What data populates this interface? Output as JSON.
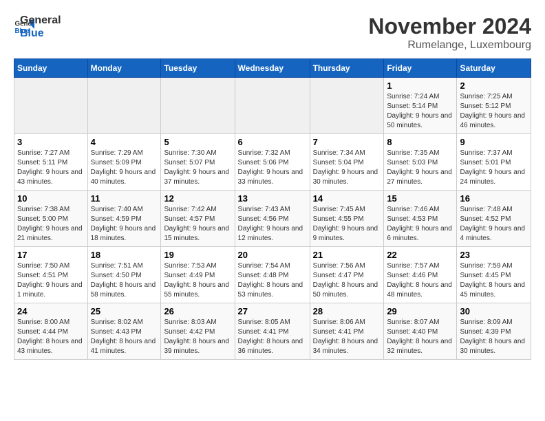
{
  "header": {
    "logo_line1": "General",
    "logo_line2": "Blue",
    "month_title": "November 2024",
    "location": "Rumelange, Luxembourg"
  },
  "days_of_week": [
    "Sunday",
    "Monday",
    "Tuesday",
    "Wednesday",
    "Thursday",
    "Friday",
    "Saturday"
  ],
  "weeks": [
    [
      {
        "day": "",
        "empty": true
      },
      {
        "day": "",
        "empty": true
      },
      {
        "day": "",
        "empty": true
      },
      {
        "day": "",
        "empty": true
      },
      {
        "day": "",
        "empty": true
      },
      {
        "day": "1",
        "sunrise": "Sunrise: 7:24 AM",
        "sunset": "Sunset: 5:14 PM",
        "daylight": "Daylight: 9 hours and 50 minutes."
      },
      {
        "day": "2",
        "sunrise": "Sunrise: 7:25 AM",
        "sunset": "Sunset: 5:12 PM",
        "daylight": "Daylight: 9 hours and 46 minutes."
      }
    ],
    [
      {
        "day": "3",
        "sunrise": "Sunrise: 7:27 AM",
        "sunset": "Sunset: 5:11 PM",
        "daylight": "Daylight: 9 hours and 43 minutes."
      },
      {
        "day": "4",
        "sunrise": "Sunrise: 7:29 AM",
        "sunset": "Sunset: 5:09 PM",
        "daylight": "Daylight: 9 hours and 40 minutes."
      },
      {
        "day": "5",
        "sunrise": "Sunrise: 7:30 AM",
        "sunset": "Sunset: 5:07 PM",
        "daylight": "Daylight: 9 hours and 37 minutes."
      },
      {
        "day": "6",
        "sunrise": "Sunrise: 7:32 AM",
        "sunset": "Sunset: 5:06 PM",
        "daylight": "Daylight: 9 hours and 33 minutes."
      },
      {
        "day": "7",
        "sunrise": "Sunrise: 7:34 AM",
        "sunset": "Sunset: 5:04 PM",
        "daylight": "Daylight: 9 hours and 30 minutes."
      },
      {
        "day": "8",
        "sunrise": "Sunrise: 7:35 AM",
        "sunset": "Sunset: 5:03 PM",
        "daylight": "Daylight: 9 hours and 27 minutes."
      },
      {
        "day": "9",
        "sunrise": "Sunrise: 7:37 AM",
        "sunset": "Sunset: 5:01 PM",
        "daylight": "Daylight: 9 hours and 24 minutes."
      }
    ],
    [
      {
        "day": "10",
        "sunrise": "Sunrise: 7:38 AM",
        "sunset": "Sunset: 5:00 PM",
        "daylight": "Daylight: 9 hours and 21 minutes."
      },
      {
        "day": "11",
        "sunrise": "Sunrise: 7:40 AM",
        "sunset": "Sunset: 4:59 PM",
        "daylight": "Daylight: 9 hours and 18 minutes."
      },
      {
        "day": "12",
        "sunrise": "Sunrise: 7:42 AM",
        "sunset": "Sunset: 4:57 PM",
        "daylight": "Daylight: 9 hours and 15 minutes."
      },
      {
        "day": "13",
        "sunrise": "Sunrise: 7:43 AM",
        "sunset": "Sunset: 4:56 PM",
        "daylight": "Daylight: 9 hours and 12 minutes."
      },
      {
        "day": "14",
        "sunrise": "Sunrise: 7:45 AM",
        "sunset": "Sunset: 4:55 PM",
        "daylight": "Daylight: 9 hours and 9 minutes."
      },
      {
        "day": "15",
        "sunrise": "Sunrise: 7:46 AM",
        "sunset": "Sunset: 4:53 PM",
        "daylight": "Daylight: 9 hours and 6 minutes."
      },
      {
        "day": "16",
        "sunrise": "Sunrise: 7:48 AM",
        "sunset": "Sunset: 4:52 PM",
        "daylight": "Daylight: 9 hours and 4 minutes."
      }
    ],
    [
      {
        "day": "17",
        "sunrise": "Sunrise: 7:50 AM",
        "sunset": "Sunset: 4:51 PM",
        "daylight": "Daylight: 9 hours and 1 minute."
      },
      {
        "day": "18",
        "sunrise": "Sunrise: 7:51 AM",
        "sunset": "Sunset: 4:50 PM",
        "daylight": "Daylight: 8 hours and 58 minutes."
      },
      {
        "day": "19",
        "sunrise": "Sunrise: 7:53 AM",
        "sunset": "Sunset: 4:49 PM",
        "daylight": "Daylight: 8 hours and 55 minutes."
      },
      {
        "day": "20",
        "sunrise": "Sunrise: 7:54 AM",
        "sunset": "Sunset: 4:48 PM",
        "daylight": "Daylight: 8 hours and 53 minutes."
      },
      {
        "day": "21",
        "sunrise": "Sunrise: 7:56 AM",
        "sunset": "Sunset: 4:47 PM",
        "daylight": "Daylight: 8 hours and 50 minutes."
      },
      {
        "day": "22",
        "sunrise": "Sunrise: 7:57 AM",
        "sunset": "Sunset: 4:46 PM",
        "daylight": "Daylight: 8 hours and 48 minutes."
      },
      {
        "day": "23",
        "sunrise": "Sunrise: 7:59 AM",
        "sunset": "Sunset: 4:45 PM",
        "daylight": "Daylight: 8 hours and 45 minutes."
      }
    ],
    [
      {
        "day": "24",
        "sunrise": "Sunrise: 8:00 AM",
        "sunset": "Sunset: 4:44 PM",
        "daylight": "Daylight: 8 hours and 43 minutes."
      },
      {
        "day": "25",
        "sunrise": "Sunrise: 8:02 AM",
        "sunset": "Sunset: 4:43 PM",
        "daylight": "Daylight: 8 hours and 41 minutes."
      },
      {
        "day": "26",
        "sunrise": "Sunrise: 8:03 AM",
        "sunset": "Sunset: 4:42 PM",
        "daylight": "Daylight: 8 hours and 39 minutes."
      },
      {
        "day": "27",
        "sunrise": "Sunrise: 8:05 AM",
        "sunset": "Sunset: 4:41 PM",
        "daylight": "Daylight: 8 hours and 36 minutes."
      },
      {
        "day": "28",
        "sunrise": "Sunrise: 8:06 AM",
        "sunset": "Sunset: 4:41 PM",
        "daylight": "Daylight: 8 hours and 34 minutes."
      },
      {
        "day": "29",
        "sunrise": "Sunrise: 8:07 AM",
        "sunset": "Sunset: 4:40 PM",
        "daylight": "Daylight: 8 hours and 32 minutes."
      },
      {
        "day": "30",
        "sunrise": "Sunrise: 8:09 AM",
        "sunset": "Sunset: 4:39 PM",
        "daylight": "Daylight: 8 hours and 30 minutes."
      }
    ]
  ]
}
